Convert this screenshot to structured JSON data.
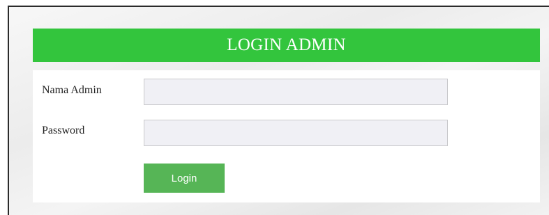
{
  "login_panel": {
    "title": "LOGIN ADMIN",
    "fields": {
      "admin_name": {
        "label": "Nama Admin",
        "value": "",
        "placeholder": ""
      },
      "password": {
        "label": "Password",
        "value": "",
        "placeholder": ""
      }
    },
    "submit_label": "Login"
  },
  "colors": {
    "header_bg": "#33c53d",
    "button_bg": "#56b556",
    "input_bg": "#f0f0f5"
  }
}
